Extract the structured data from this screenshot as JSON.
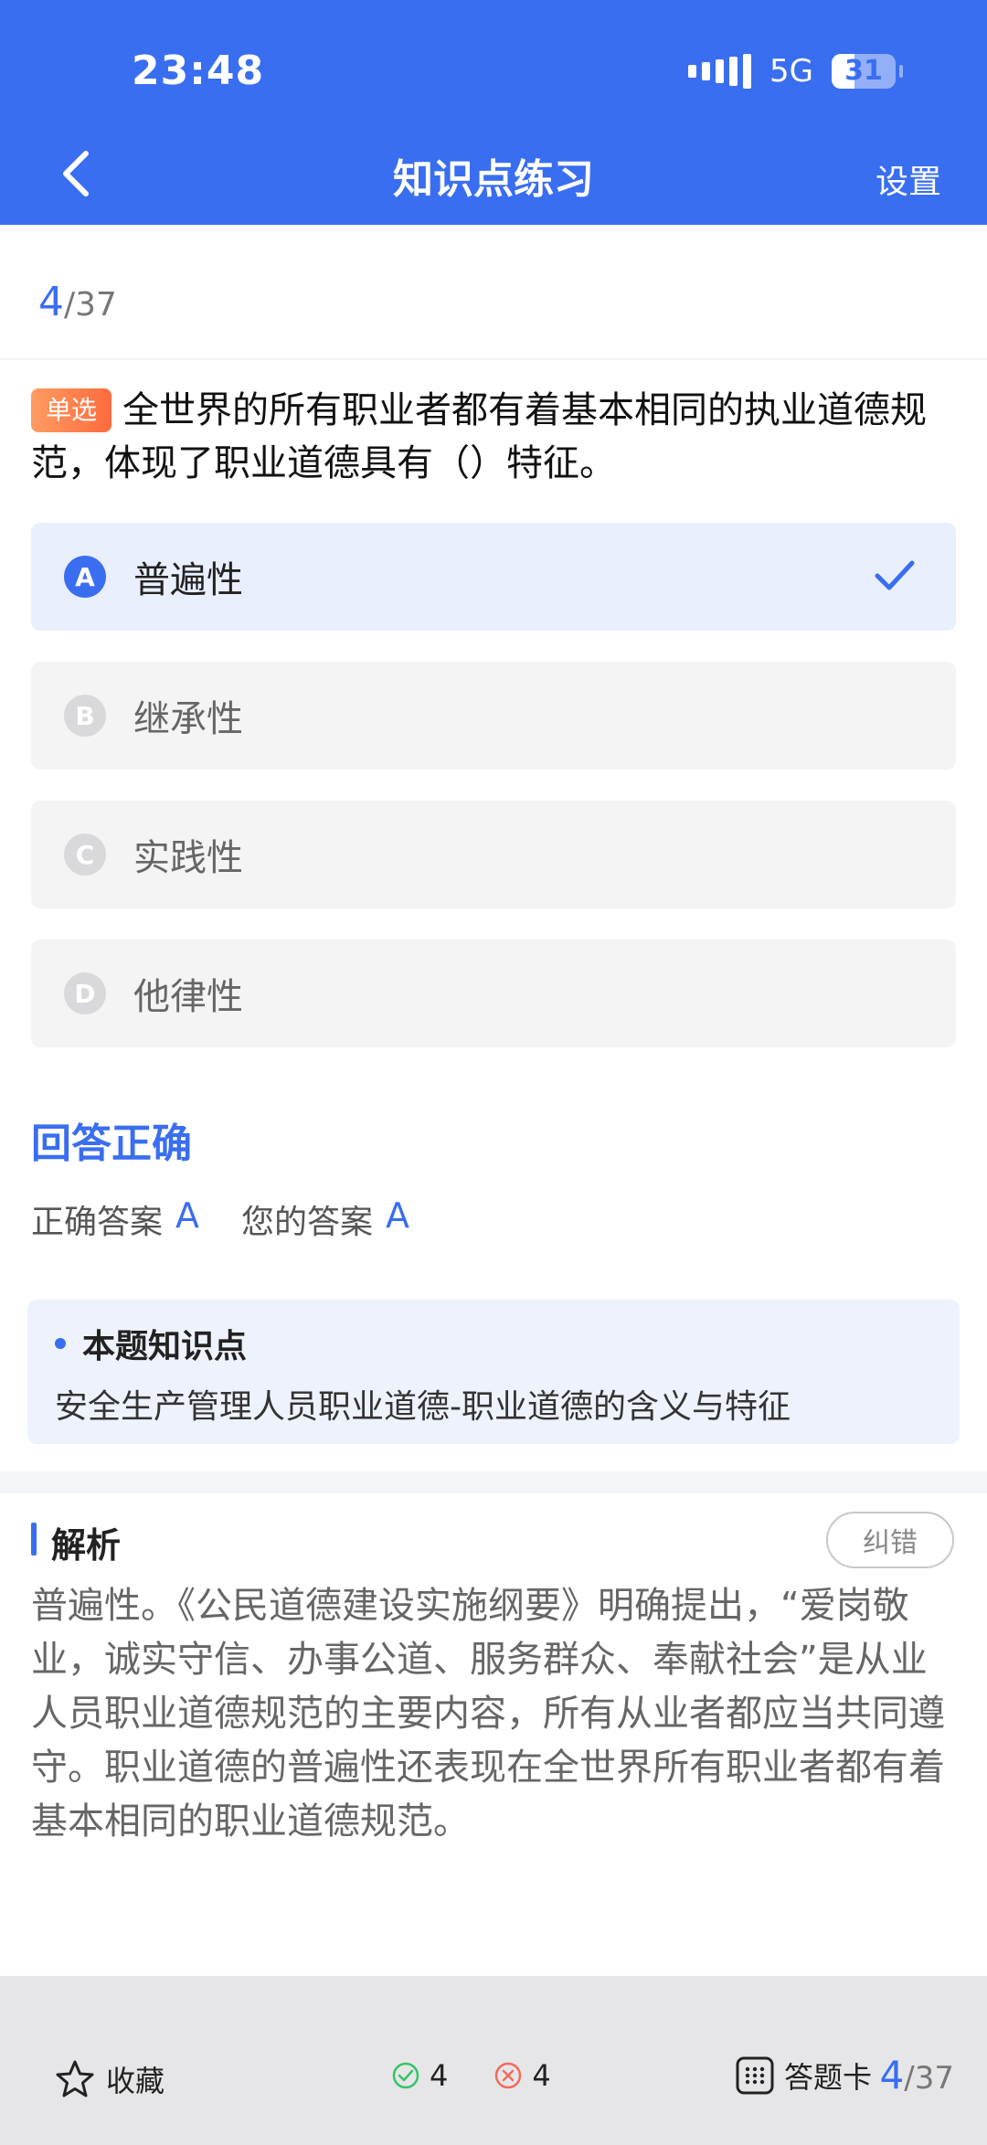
{
  "status_bar": {
    "time": "23:48",
    "network": "5G",
    "battery": "31"
  },
  "header": {
    "title": "知识点练习",
    "settings_label": "设置"
  },
  "progress": {
    "current": "4",
    "total": "/37"
  },
  "question": {
    "type_tag": "单选",
    "text": "全世界的所有职业者都有着基本相同的执业道德规范，体现了职业道德具有（）特征。"
  },
  "options": [
    {
      "letter": "A",
      "text": "普遍性",
      "selected": true
    },
    {
      "letter": "B",
      "text": "继承性",
      "selected": false
    },
    {
      "letter": "C",
      "text": "实践性",
      "selected": false
    },
    {
      "letter": "D",
      "text": "他律性",
      "selected": false
    }
  ],
  "result": {
    "title": "回答正确",
    "correct_label": "正确答案",
    "correct_value": "A",
    "your_label": "您的答案",
    "your_value": "A"
  },
  "knowledge_point": {
    "title": "本题知识点",
    "text": "安全生产管理人员职业道德-职业道德的含义与特征"
  },
  "analysis": {
    "title": "解析",
    "report_label": "纠错",
    "text": "普遍性。《公民道德建设实施纲要》明确提出，“爱岗敬业，诚实守信、办事公道、服务群众、奉献社会”是从业人员职业道德规范的主要内容，所有从业者都应当共同遵守。职业道德的普遍性还表现在全世界所有职业者都有着基本相同的职业道德规范。"
  },
  "bottom_bar": {
    "favorite_label": "收藏",
    "correct_count": "4",
    "wrong_count": "4",
    "answer_card_label": "答题卡",
    "progress_current": "4",
    "progress_total": "/37"
  },
  "colors": {
    "accent": "#3a6ef0",
    "tag": "#ff7a45",
    "wrong": "#f26b5b",
    "right": "#35c46b"
  },
  "icons": [
    "back-icon",
    "check-icon",
    "star-icon",
    "correct-circle-icon",
    "wrong-circle-icon",
    "grid-icon"
  ]
}
